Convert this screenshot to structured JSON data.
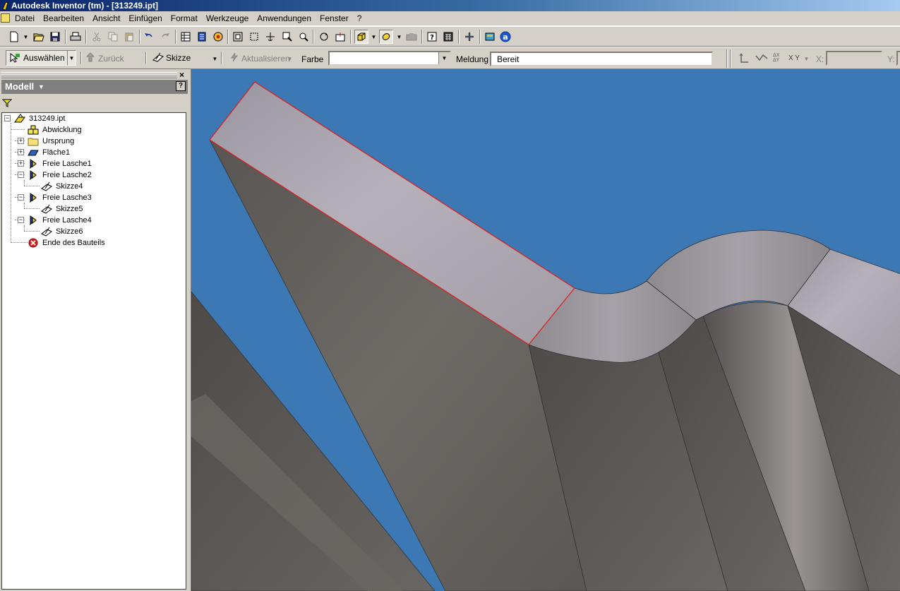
{
  "window": {
    "title": "Autodesk Inventor (tm) - [313249.ipt]"
  },
  "menu": [
    "Datei",
    "Bearbeiten",
    "Ansicht",
    "Einfügen",
    "Format",
    "Werkzeuge",
    "Anwendungen",
    "Fenster",
    "?"
  ],
  "command_bar": {
    "select_label": "Auswählen",
    "back_label": "Zurück",
    "sketch_label": "Skizze",
    "update_label": "Aktualisieren",
    "color_label": "Farbe",
    "color_value": "",
    "message_label": "Meldung",
    "message_value": "Bereit",
    "x_label": "X:",
    "y_label": "Y:",
    "xy_label": "X Y"
  },
  "browser": {
    "header": "Modell",
    "tree": [
      {
        "label": "313249.ipt",
        "icon": "part-icon",
        "expander": "minus"
      },
      {
        "label": "Abwicklung",
        "icon": "flat-pattern-icon",
        "expander": ""
      },
      {
        "label": "Ursprung",
        "icon": "folder-icon",
        "expander": "plus"
      },
      {
        "label": "Fläche1",
        "icon": "face-icon",
        "expander": "plus"
      },
      {
        "label": "Freie Lasche1",
        "icon": "contour-flange-icon",
        "expander": "plus"
      },
      {
        "label": "Freie Lasche2",
        "icon": "contour-flange-icon",
        "expander": "minus"
      },
      {
        "label": "Skizze4",
        "icon": "sketch-icon",
        "expander": ""
      },
      {
        "label": "Freie Lasche3",
        "icon": "contour-flange-icon",
        "expander": "minus"
      },
      {
        "label": "Skizze5",
        "icon": "sketch-icon",
        "expander": ""
      },
      {
        "label": "Freie Lasche4",
        "icon": "contour-flange-icon",
        "expander": "minus"
      },
      {
        "label": "Skizze6",
        "icon": "sketch-icon",
        "expander": ""
      },
      {
        "label": "Ende des Bauteils",
        "icon": "end-of-part-icon",
        "expander": ""
      }
    ]
  },
  "colors": {
    "viewport_background": "#3c78b4",
    "title_gradient_start": "#0a246a",
    "highlight_edge": "#e02020"
  }
}
